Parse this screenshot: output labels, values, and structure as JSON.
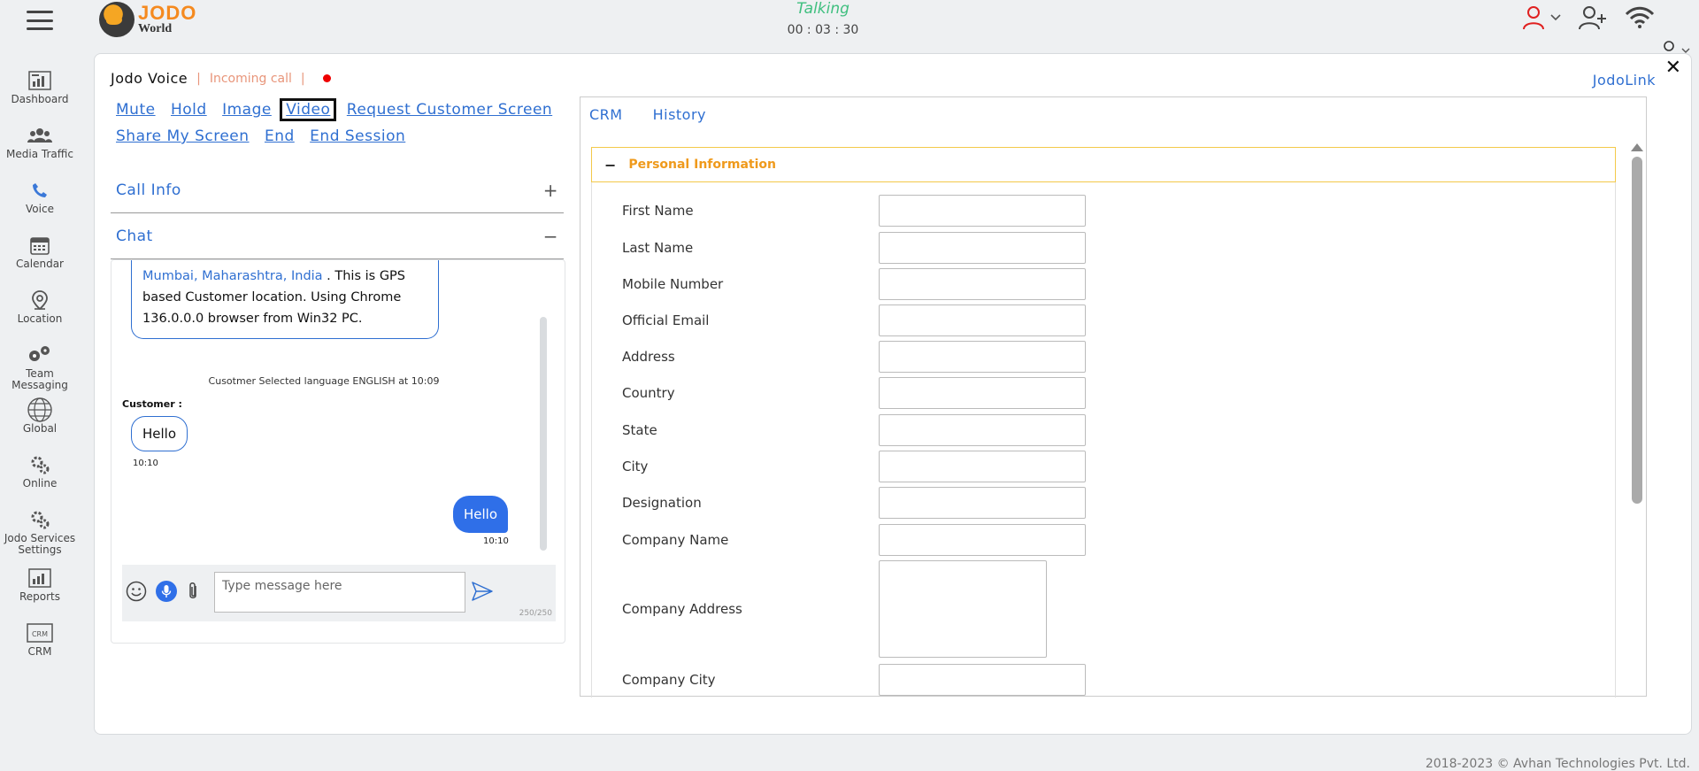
{
  "header": {
    "logo_top": "JODO",
    "logo_bottom": "World",
    "call_status": "Talking",
    "call_timer": "00 : 03 : 30"
  },
  "sidebar": {
    "items": [
      {
        "label": "Dashboard",
        "icon": "dashboard-icon"
      },
      {
        "label": "Media Traffic",
        "icon": "people-icon"
      },
      {
        "label": "Voice",
        "icon": "phone-icon"
      },
      {
        "label": "Calendar",
        "icon": "calendar-icon"
      },
      {
        "label": "Location",
        "icon": "location-pin-icon"
      },
      {
        "label": "Team Messaging",
        "icon": "chat-users-icon"
      },
      {
        "label": "Global",
        "icon": "globe-icon"
      },
      {
        "label": "Online",
        "icon": "gears-icon"
      },
      {
        "label": "Jodo Services Settings",
        "icon": "gears-icon"
      },
      {
        "label": "Reports",
        "icon": "report-icon"
      },
      {
        "label": "CRM",
        "icon": "crm-icon"
      }
    ]
  },
  "voice": {
    "title": "Jodo Voice",
    "separator": "|",
    "status": "Incoming call",
    "actions": [
      "Mute",
      "Hold",
      "Image",
      "Video",
      "Request Customer Screen",
      "Share My Screen",
      "End",
      "End Session"
    ]
  },
  "accordion": {
    "call_info": "Call Info",
    "call_info_symbol": "+",
    "chat": "Chat",
    "chat_symbol": "−"
  },
  "chat": {
    "location_link": "Mumbai, Maharashtra, India",
    "location_text": " . This is GPS based Customer location. Using Chrome 136.0.0.0 browser from Win32 PC.",
    "system_message": "Cusotmer Selected language ENGLISH at 10:09",
    "customer_label": "Customer :",
    "incoming_text": "Hello",
    "incoming_time": "10:10",
    "outgoing_text": "Hello",
    "outgoing_time": "10:10",
    "input_placeholder": "Type message here",
    "counter": "250/250"
  },
  "crm": {
    "jodolink": "JodoLink",
    "tabs": [
      "CRM",
      "History"
    ],
    "section_title": "Personal Information",
    "section_symbol": "−",
    "fields": [
      "First Name",
      "Last Name",
      "Mobile Number",
      "Official Email",
      "Address",
      "Country",
      "State",
      "City",
      "Designation",
      "Company Name"
    ],
    "textarea_field": "Company Address",
    "last_field": "Company City"
  },
  "footer": {
    "copyright": "2018-2023 © Avhan Technologies Pvt. Ltd."
  },
  "colors": {
    "accent": "#2f6fd1",
    "status_green": "#3fbf7f",
    "incoming_orange": "#e8957a",
    "section_orange": "#ef9a1c"
  }
}
